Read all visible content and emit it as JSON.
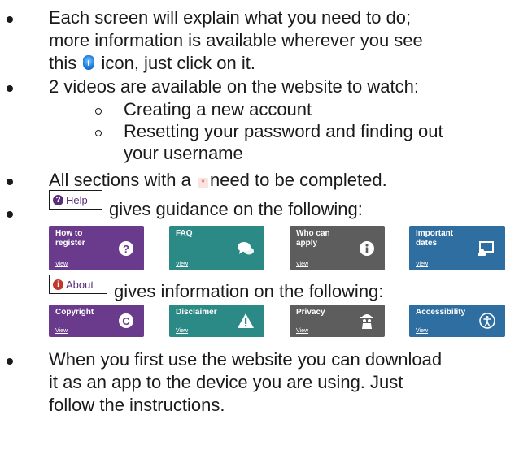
{
  "bullets": {
    "b1": {
      "line1": "Each screen will explain what you need to do;",
      "line2": "more information is available wherever you see",
      "line3_pre": "this ",
      "line3_post": " icon, just click on it."
    },
    "b2": {
      "line1": "2 videos are available on the website to watch:",
      "sub1": "Creating a new account",
      "sub2_line1": "Resetting your password and finding out",
      "sub2_line2": "your username"
    },
    "b3": {
      "pre": "All sections with a ",
      "star": "*",
      "post": "need to be completed."
    },
    "b4": {
      "chip_label": "Help",
      "text": "gives guidance on the following:"
    },
    "b5": {
      "chip_label": "About",
      "text": "gives information on the following:"
    },
    "b6": {
      "line1": "When you first use the website you can download",
      "line2": "it as an app to the device you are using. Just",
      "line3": "follow the instructions."
    }
  },
  "help_tiles": [
    {
      "title": "How to\nregister",
      "link": "View",
      "color": "#6a3a8c",
      "icon": "question-icon"
    },
    {
      "title": "FAQ",
      "link": "View",
      "color": "#2b8a86",
      "icon": "chat-bubbles-icon"
    },
    {
      "title": "Who can\napply",
      "link": "View",
      "color": "#5d5d5d",
      "icon": "info-icon"
    },
    {
      "title": "Important\ndates",
      "link": "View",
      "color": "#2f6ea1",
      "icon": "screen-share-icon"
    }
  ],
  "about_tiles": [
    {
      "title": "Copyright",
      "link": "View",
      "color": "#6a3a8c",
      "icon": "copyright-icon"
    },
    {
      "title": "Disclaimer",
      "link": "View",
      "color": "#2b8a86",
      "icon": "warning-icon"
    },
    {
      "title": "Privacy",
      "link": "View",
      "color": "#5d5d5d",
      "icon": "privacy-icon"
    },
    {
      "title": "Accessibility",
      "link": "View",
      "color": "#2f6ea1",
      "icon": "accessibility-icon"
    }
  ],
  "colors": {
    "help_chip_text": "#5a2d7a",
    "required_star": "#e0433a",
    "info_icon": "#1f7fe0"
  }
}
